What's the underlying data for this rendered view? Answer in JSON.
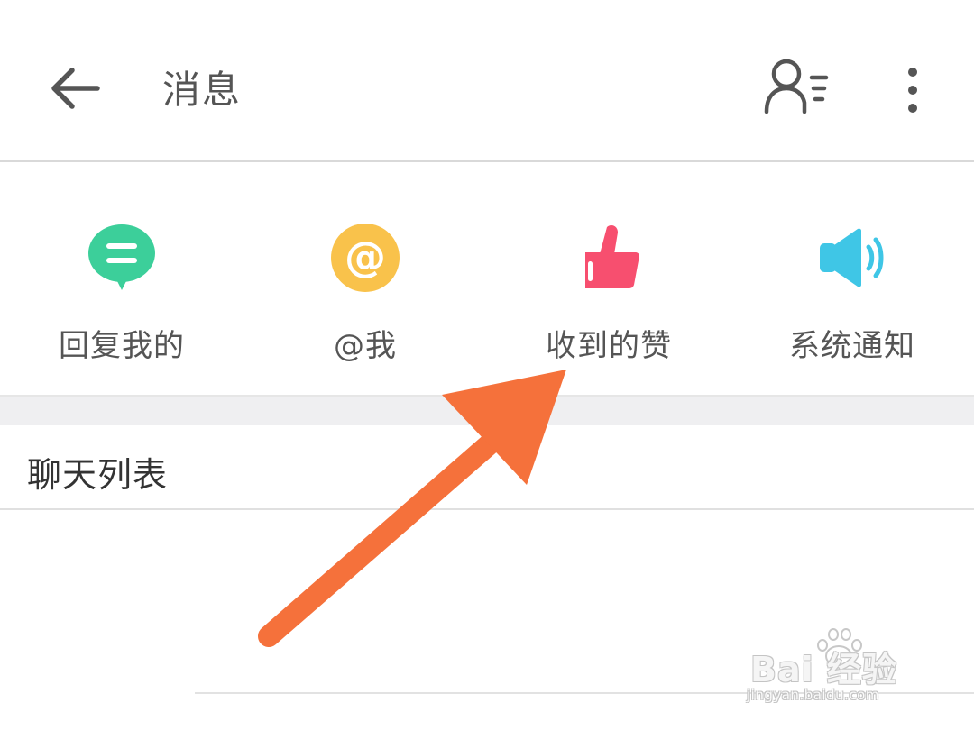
{
  "header": {
    "title": "消息",
    "back_icon": "arrow-left-icon",
    "contacts_icon": "person-list-icon",
    "more_icon": "more-vertical-icon"
  },
  "quick_actions": [
    {
      "label": "回复我的",
      "icon": "chat-bubble-icon",
      "color": "#3ccf9a"
    },
    {
      "label": "@我",
      "icon": "at-sign-icon",
      "color": "#f9c24b"
    },
    {
      "label": "收到的赞",
      "icon": "thumbs-up-icon",
      "color": "#f74f6f"
    },
    {
      "label": "系统通知",
      "icon": "speaker-icon",
      "color": "#3fc6e6"
    }
  ],
  "chat_section": {
    "title": "聊天列表"
  },
  "annotation": {
    "arrow_color": "#f5713b"
  },
  "watermark": {
    "brand": "Bai 经验",
    "url": "jingyan.baidu.com"
  }
}
